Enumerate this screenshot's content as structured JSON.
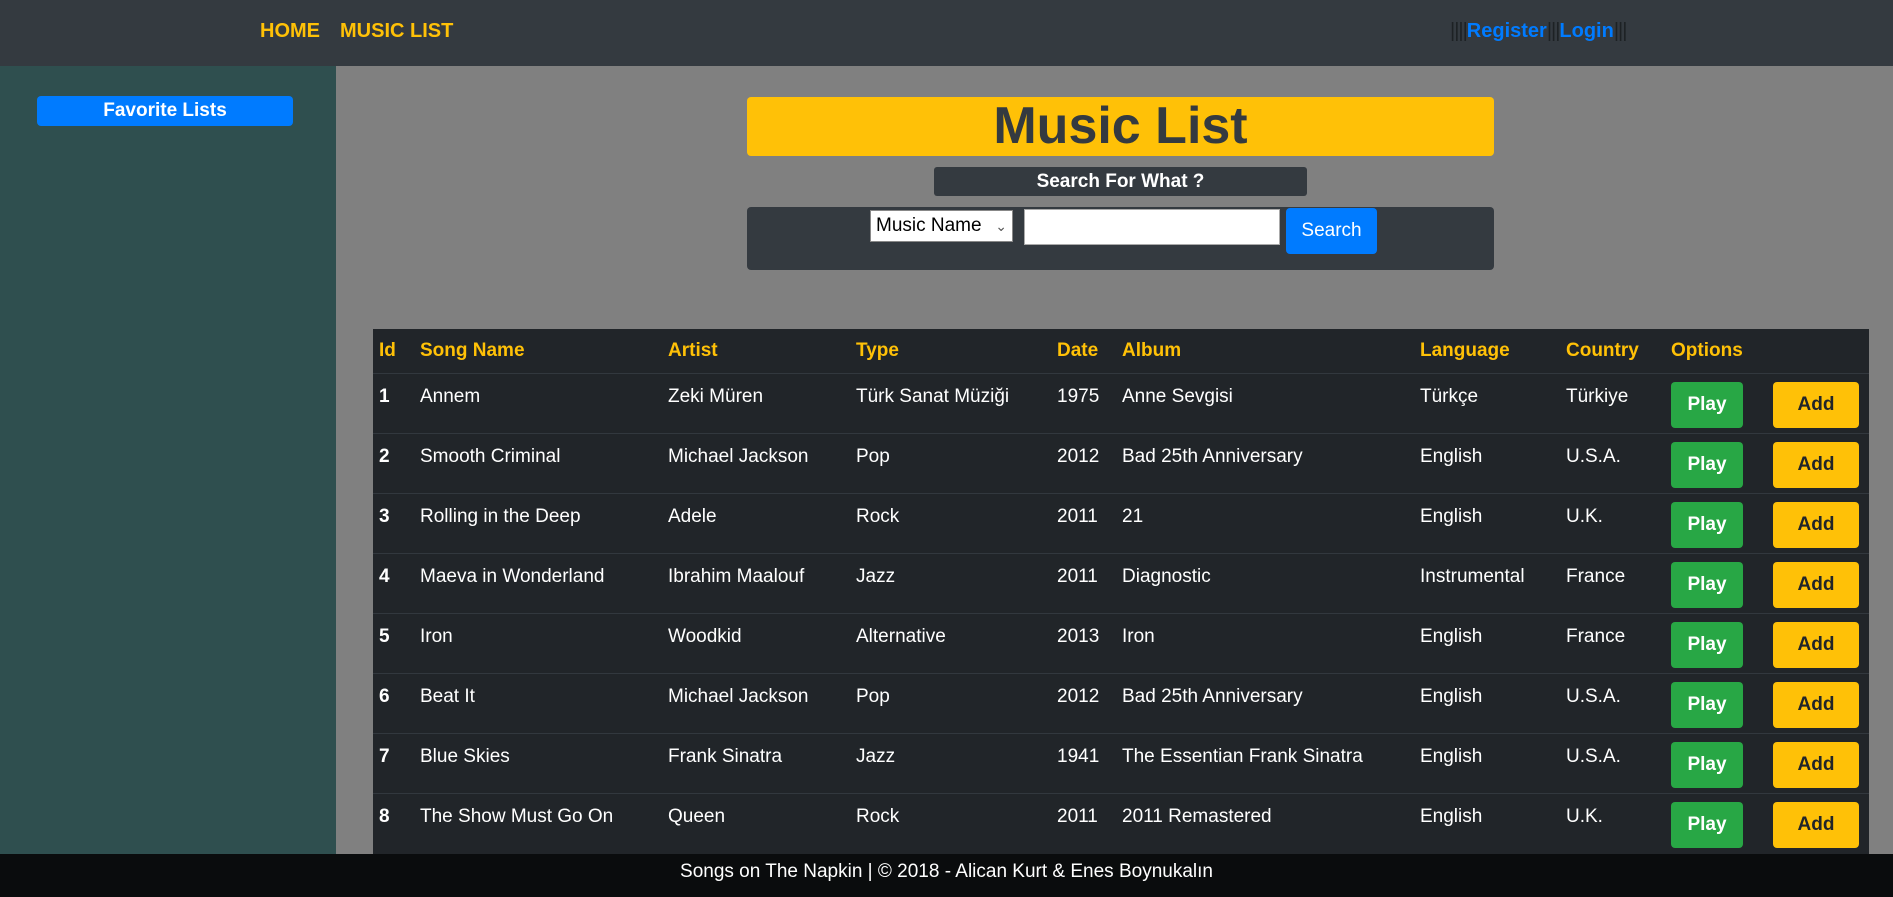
{
  "nav": {
    "home": "HOME",
    "music_list": "MUSIC LIST",
    "register": "Register",
    "login": "Login",
    "sep_left": "||||",
    "sep_mid": "|||",
    "sep_right": "|||"
  },
  "sidebar": {
    "favorite_lists": "Favorite Lists"
  },
  "main": {
    "title": "Music List",
    "search_label": "Search For What ?",
    "search_select": "Music Name",
    "search_input_value": "",
    "search_button": "Search"
  },
  "table": {
    "headers": [
      "Id",
      "Song Name",
      "Artist",
      "Type",
      "Date",
      "Album",
      "Language",
      "Country",
      "Options",
      ""
    ],
    "play_label": "Play",
    "add_label": "Add",
    "rows": [
      {
        "id": "1",
        "song": "Annem",
        "artist": "Zeki Müren",
        "type": "Türk Sanat Müziği",
        "date": "1975",
        "album": "Anne Sevgisi",
        "language": "Türkçe",
        "country": "Türkiye"
      },
      {
        "id": "2",
        "song": "Smooth Criminal",
        "artist": "Michael Jackson",
        "type": "Pop",
        "date": "2012",
        "album": "Bad 25th Anniversary",
        "language": "English",
        "country": "U.S.A."
      },
      {
        "id": "3",
        "song": "Rolling in the Deep",
        "artist": "Adele",
        "type": "Rock",
        "date": "2011",
        "album": "21",
        "language": "English",
        "country": "U.K."
      },
      {
        "id": "4",
        "song": "Maeva in Wonderland",
        "artist": "Ibrahim Maalouf",
        "type": "Jazz",
        "date": "2011",
        "album": "Diagnostic",
        "language": "Instrumental",
        "country": "France"
      },
      {
        "id": "5",
        "song": "Iron",
        "artist": "Woodkid",
        "type": "Alternative",
        "date": "2013",
        "album": "Iron",
        "language": "English",
        "country": "France"
      },
      {
        "id": "6",
        "song": "Beat It",
        "artist": "Michael Jackson",
        "type": "Pop",
        "date": "2012",
        "album": "Bad 25th Anniversary",
        "language": "English",
        "country": "U.S.A."
      },
      {
        "id": "7",
        "song": "Blue Skies",
        "artist": "Frank Sinatra",
        "type": "Jazz",
        "date": "1941",
        "album": "The Essentian Frank Sinatra",
        "language": "English",
        "country": "U.S.A."
      },
      {
        "id": "8",
        "song": "The Show Must Go On",
        "artist": "Queen",
        "type": "Rock",
        "date": "2011",
        "album": "2011 Remastered",
        "language": "English",
        "country": "U.K."
      }
    ]
  },
  "footer": {
    "text": "Songs on The Napkin | © 2018 - Alican Kurt & Enes Boynukalın"
  },
  "colors": {
    "navbar": "#343a40",
    "accent_yellow": "#ffc107",
    "primary_blue": "#007bff",
    "success_green": "#28a745",
    "sidebar": "#2f4f4f",
    "table_bg": "#212529"
  }
}
